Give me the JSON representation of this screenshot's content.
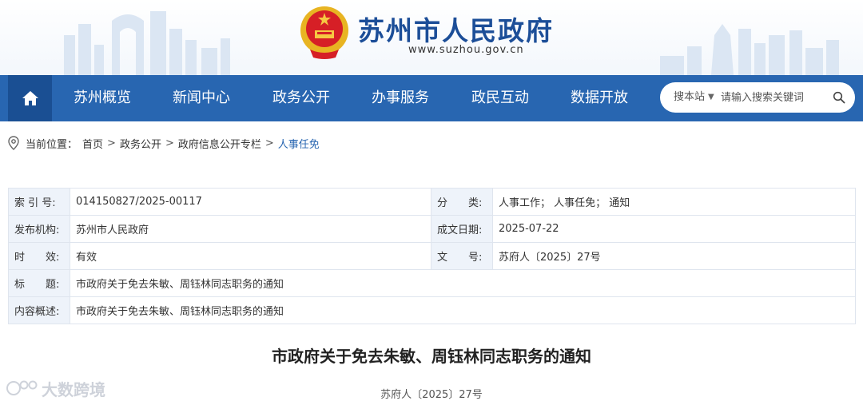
{
  "header": {
    "title": "苏州市人民政府",
    "url": "www.suzhou.gov.cn"
  },
  "nav": {
    "items": [
      "苏州概览",
      "新闻中心",
      "政务公开",
      "办事服务",
      "政民互动",
      "数据开放"
    ]
  },
  "search": {
    "scope": "搜本站",
    "placeholder": "请输入搜索关键词"
  },
  "breadcrumb": {
    "prefix": "当前位置：",
    "items": [
      "首页",
      "政务公开",
      "政府信息公开专栏",
      "人事任免"
    ],
    "separator": ">"
  },
  "meta": {
    "index_label": "索 引 号:",
    "index_value": "014150827/2025-00117",
    "category_label": "分　　类:",
    "category_value": "人事工作；  人事任免；  通知",
    "publisher_label": "发布机构:",
    "publisher_value": "苏州市人民政府",
    "date_label": "成文日期:",
    "date_value": "2025-07-22",
    "validity_label": "时　　效:",
    "validity_value": "有效",
    "docno_label": "文　　号:",
    "docno_value": "苏府人〔2025〕27号",
    "title_label": "标　　题:",
    "title_value": "市政府关于免去朱敏、周钰林同志职务的通知",
    "summary_label": "内容概述:",
    "summary_value": "市政府关于免去朱敏、周钰林同志职务的通知"
  },
  "article": {
    "title": "市政府关于免去朱敏、周钰林同志职务的通知",
    "doc_no": "苏府人〔2025〕27号"
  },
  "watermark": {
    "text": "大数跨境"
  },
  "colors": {
    "nav_bg": "#2866b1",
    "home_bg": "#1a4f93",
    "title_blue": "#1c4e98",
    "label_bg": "#eef3fa"
  }
}
